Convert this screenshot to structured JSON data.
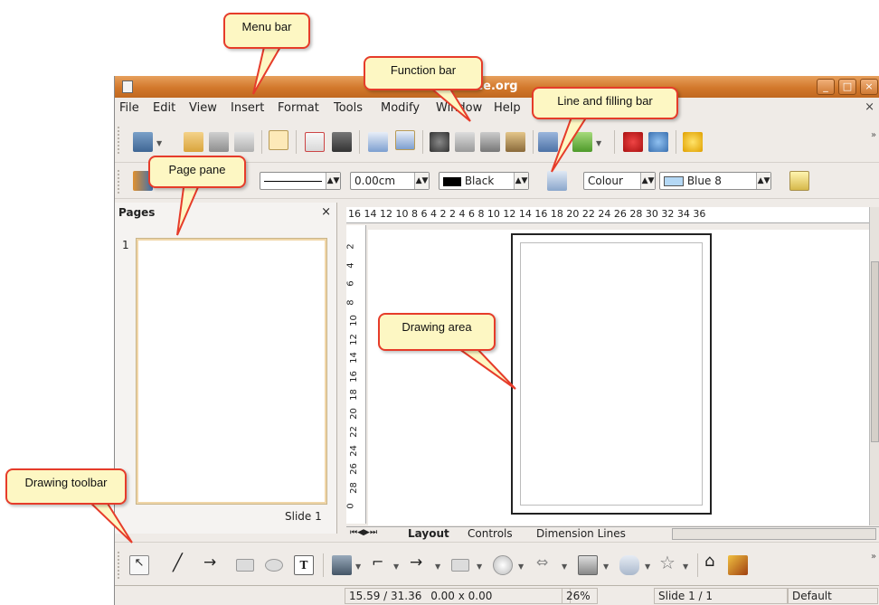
{
  "window": {
    "title": "ice.org",
    "minimize_label": "_",
    "maximize_label": "□",
    "close_label": "×"
  },
  "menu": [
    "File",
    "Edit",
    "View",
    "Insert",
    "Format",
    "Tools",
    "Modify",
    "Window",
    "Help"
  ],
  "menu_close": "×",
  "line_bar": {
    "width_value": "0.00cm",
    "line_color": "Black",
    "fill_type": "Colour",
    "fill_color": "Blue 8"
  },
  "pages_pane": {
    "title": "Pages",
    "close": "×",
    "slide_number": "1",
    "slide_label": "Slide 1"
  },
  "ruler": {
    "h_ticks": "16 14 12 10  8   6   4   2         2   4   6   8  10 12 14 16 18 20 22 24 26 28 30 32 34 36",
    "v_ticks": [
      "2",
      "4",
      "6",
      "8",
      "10",
      "12",
      "14",
      "16",
      "18",
      "20",
      "22",
      "24",
      "26",
      "28",
      "0"
    ]
  },
  "tabs": [
    "Layout",
    "Controls",
    "Dimension Lines"
  ],
  "status": {
    "position": "15.59 / 31.36",
    "size": "0.00 x 0.00",
    "zoom": "26%",
    "slide": "Slide 1 / 1",
    "layout": "Default"
  },
  "callouts": {
    "menu_bar": "Menu bar",
    "function_bar": "Function bar",
    "line_filling_bar": "Line and filling bar",
    "page_pane": "Page pane",
    "drawing_area": "Drawing area",
    "drawing_toolbar": "Drawing toolbar"
  },
  "colors": {
    "title_orange": "#d2782b",
    "callout_border": "#e63c2a",
    "callout_fill": "#fdf7c3",
    "fill_blue8": "#b4d8f5"
  }
}
